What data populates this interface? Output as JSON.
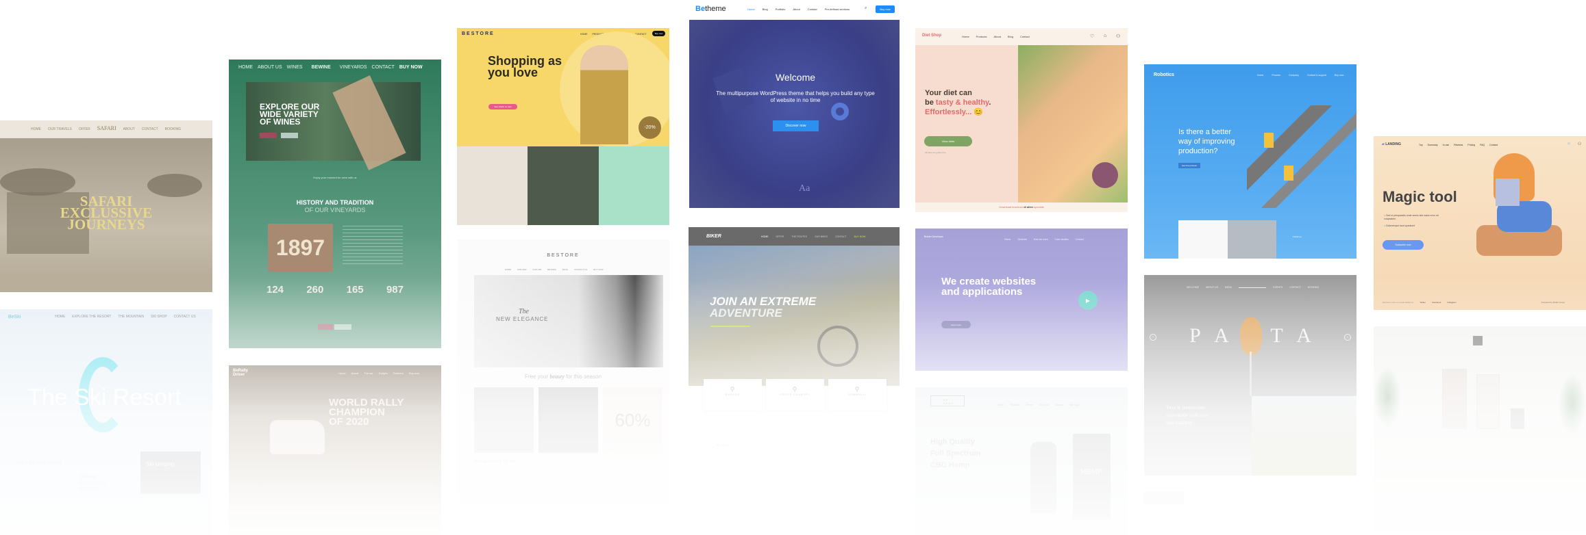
{
  "colors": {
    "betheme_blue": "#1d8cf8",
    "wine_green": "#4a8a6c",
    "shop_yellow": "#f7d76a",
    "diet_red": "#e26a6a",
    "robotics_blue": "#4aa3ee",
    "landing_peach": "#f8dcb8",
    "websites_purple": "#a9a6dc"
  },
  "betheme": {
    "logo_be": "Be",
    "logo_theme": "theme",
    "nav": [
      "Home",
      "Blog",
      "Portfolio",
      "About",
      "Contact",
      "Pre-defined sections"
    ],
    "search_icon": "search-icon",
    "buy": "Buy now",
    "title": "Welcome",
    "subtitle": "The multipurpose WordPress theme that helps you build any type of website in no time",
    "cta": "Discover now",
    "aa": "Aa"
  },
  "safari": {
    "nav_left": [
      "HOME",
      "OUR TRAVELS",
      "OFFER"
    ],
    "logo": "SAFARI",
    "nav_right": [
      "ABOUT",
      "CONTACT",
      "BOOKING"
    ],
    "title": [
      "SAFARI",
      "EXCLUSSIVE",
      "JOURNEYS"
    ]
  },
  "ski": {
    "logo": "BeSki",
    "nav": [
      "HOME",
      "EXPLORE THE RESORT",
      "THE MOUNTAIN",
      "SKI SHOP",
      "CONTACT US"
    ],
    "title": "The Ski Resort",
    "tiles": [
      "Find perfect resort",
      "Ski and snowboard lessons",
      "Ski jumping"
    ]
  },
  "wine": {
    "nav_left": [
      "HOME",
      "ABOUT US",
      "WINES"
    ],
    "logo": "BEWINE",
    "nav_right": [
      "VINEYARDS",
      "CONTACT",
      "BUY NOW"
    ],
    "hero": [
      "EXPLORE OUR",
      "WIDE VARIETY",
      "OF WINES"
    ],
    "tagline": "Enjoy your moment for wine with us",
    "section_title": "HISTORY AND TRADITION",
    "section_sub": "OF OUR VINEYARDS",
    "year": "1897",
    "stats": [
      "124",
      "260",
      "165",
      "987"
    ]
  },
  "rally": {
    "logo": "BeRally Driver",
    "nav": [
      "Home",
      "About",
      "The car",
      "Rallyes",
      "Partners",
      "Buy now"
    ],
    "title": [
      "WORLD RALLY",
      "CHAMPION",
      "OF 2020"
    ]
  },
  "shop": {
    "logo": "BESTORE",
    "nav": [
      "HOME",
      "PRODUCTS",
      "ABOUT",
      "BLOG",
      "CONTACT"
    ],
    "buy": "Buy now",
    "title": [
      "Shopping as",
      "you love"
    ],
    "cta": "See what's on sale",
    "badge": "-20%"
  },
  "bestore2": {
    "logo": "BESTORE",
    "nav": [
      "HOME",
      "FOR HER",
      "FOR HIM",
      "BRANDS",
      "BLOG",
      "CONTACT US",
      "BUY NOW"
    ],
    "title_the": "The",
    "title": "NEW ELEGANCE",
    "tagline_pre": "Free your",
    "tagline_em": "beauty",
    "tagline_post": "for this season",
    "sale": "60%",
    "picked_pre": "Best",
    "picked_em": "picked stuff",
    "picked_post": "for her"
  },
  "biker": {
    "logo": "BIKER",
    "nav": [
      "HOME",
      "OFFER",
      "THE ROUTES",
      "OUR BIKES",
      "CONTACT",
      "BUY NOW"
    ],
    "title": [
      "JOIN AN EXTREME",
      "ADVENTURE"
    ],
    "categories": [
      "ENDURO",
      "CROSS COUNTRY",
      "DOWNHILL"
    ],
    "shop": "BE SHOP"
  },
  "diet": {
    "logo": "Diet Shop",
    "nav": [
      "Home",
      "Products",
      "About",
      "Blog",
      "Contact"
    ],
    "title_1": "Your diet can",
    "title_2a": "be ",
    "title_2b": "tasty & healthy",
    "title_2c": ".",
    "title_3": "Effortlessly... 😊",
    "cta": "View diets",
    "note": "All diets are gluten free",
    "footer_pre": "Download brochure",
    "footer_mid": "di alien",
    "footer_post": "specials"
  },
  "websites": {
    "logo": "Builder Developer",
    "nav": [
      "Home",
      "Services",
      "How we work",
      "Case studies",
      "Contact"
    ],
    "title": [
      "We create websites",
      "and applications"
    ],
    "cta": "Learn more"
  },
  "cbd": {
    "logo": "BE HEMP",
    "nav": [
      "Home",
      "Products",
      "Theme",
      "About us",
      "Contact",
      "Buy now"
    ],
    "title": [
      "High Quality",
      "Full Spectrum",
      "CBD Hemp"
    ],
    "box": "HEMP"
  },
  "robotics": {
    "logo": "Robotics",
    "nav": [
      "Home",
      "Process",
      "Company",
      "Contact & support",
      "Buy now"
    ],
    "title": [
      "Is there a better",
      "way of improving",
      "production?"
    ],
    "cta": "See the process",
    "follow": "Follow us"
  },
  "pasta": {
    "nav_left": [
      "WELCOME",
      "ABOUT US",
      "MENU"
    ],
    "nav_right": [
      "EVENTS",
      "CONTACT",
      "BOOKING"
    ],
    "title": "PASTA",
    "sub": [
      "True & memorable",
      "taste made with love",
      "and tradition"
    ]
  },
  "landing": {
    "logo": "LANDING",
    "nav": [
      "Top",
      "Summary",
      "In use",
      "Reviews",
      "Pricing",
      "FAQ",
      "Contact"
    ],
    "title": "Magic tool",
    "bullets": [
      "Sed ut perspiciatis unde omnis iste natus error sit voluptatem.",
      "Doloremque laud quantum!"
    ],
    "cta": "Subscribe now",
    "footer": "Discover more on social platforms",
    "social": [
      "Twitter",
      "Facebook",
      "Instagram"
    ],
    "powered": "Powered by Muffin Group"
  }
}
